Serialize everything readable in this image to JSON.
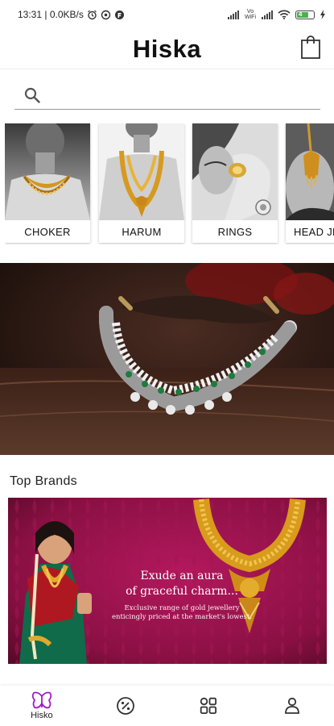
{
  "status_bar": {
    "time_info": "13:31 | 0.0KB/s",
    "volte": "Vo WiFi",
    "battery_level": "4"
  },
  "header": {
    "title": "Hiska",
    "bag_icon": "shopping-bag-icon"
  },
  "search": {
    "placeholder": "",
    "icon": "search-icon"
  },
  "categories": [
    {
      "label": "CHOKER"
    },
    {
      "label": "HARUM"
    },
    {
      "label": "RINGS"
    },
    {
      "label": "HEAD JEWELLERY"
    }
  ],
  "top_brands": {
    "title": "Top Brands",
    "banner_headline_1": "Exude an aura",
    "banner_headline_2": "of graceful charm...",
    "banner_sub_1": "Exclusive range of gold jewellery",
    "banner_sub_2": "enticingly priced at the market's lowest."
  },
  "bottom_nav": {
    "items": [
      {
        "label": "Hisko",
        "icon": "butterfly-icon",
        "active": true
      },
      {
        "label": "",
        "icon": "percent-icon"
      },
      {
        "label": "",
        "icon": "grid-icon"
      },
      {
        "label": "",
        "icon": "user-icon"
      }
    ]
  },
  "colors": {
    "accent": "#a21cc9",
    "brand_banner_bg": "#8a1043",
    "gold": "#d89b1c"
  }
}
